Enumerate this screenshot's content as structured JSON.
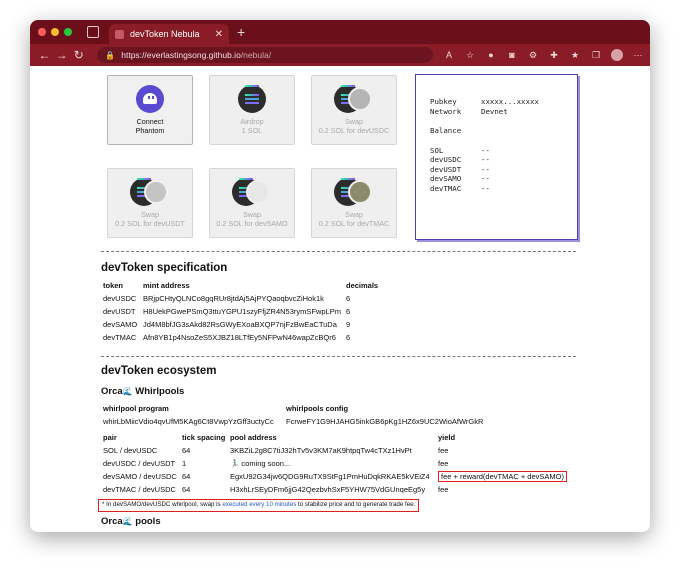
{
  "browser": {
    "tab_title": "devToken Nebula",
    "tab_close": "✕",
    "new_tab": "+",
    "url_domain": "https://everlastingsong.github.io",
    "url_path": "/nebula/"
  },
  "cards": [
    {
      "name": "connect-phantom-card",
      "line1": "Connect",
      "line2": "Phantom",
      "icon": "phantom-icon",
      "active": true
    },
    {
      "name": "airdrop-card",
      "line1": "Airdrop",
      "line2": "1 SOL",
      "icon": "solana-icon"
    },
    {
      "name": "swap-usdc-card",
      "line1": "Swap",
      "line2": "0.2 SOL for devUSDC",
      "icon": "solana-usdc-icon"
    },
    {
      "name": "swap-usdt-card",
      "line1": "Swap",
      "line2": "0.2 SOL for devUSDT",
      "icon": "solana-usdt-icon"
    },
    {
      "name": "swap-samo-card",
      "line1": "Swap",
      "line2": "0.2 SOL for devSAMO",
      "icon": "solana-samo-icon"
    },
    {
      "name": "swap-tmac-card",
      "line1": "Swap",
      "line2": "0.2 SOL for devTMAC",
      "icon": "solana-tmac-icon"
    }
  ],
  "info": {
    "pubkey_label": "Pubkey",
    "pubkey_value": "xxxxx...xxxxx",
    "network_label": "Network",
    "network_value": "Devnet",
    "balance_label": "Balance",
    "balances": [
      {
        "token": "SOL",
        "value": "--"
      },
      {
        "token": "devUSDC",
        "value": "--"
      },
      {
        "token": "devUSDT",
        "value": "--"
      },
      {
        "token": "devSAMO",
        "value": "--"
      },
      {
        "token": "devTMAC",
        "value": "--"
      }
    ]
  },
  "spec": {
    "heading": "devToken specification",
    "headers": [
      "token",
      "mint address",
      "decimals"
    ],
    "rows": [
      [
        "devUSDC",
        "BRjpCHtyQLNCo8gqRUr8jtdAj5AjPYQaoqbvcZiHok1k",
        "6"
      ],
      [
        "devUSDT",
        "H8UekPGwePSmQ3ttuYGPU1szyFfjZR4N53rymSFwpLPm",
        "6"
      ],
      [
        "devSAMO",
        "Jd4M8bfJG3sAkd82RsGWyEXoaBXQP7njFzBwEaCTuDa",
        "9"
      ],
      [
        "devTMAC",
        "Afn8YB1p4NsoZeS5XJBZ18LTfEy5NFPwN46wapZcBQr6",
        "6"
      ]
    ]
  },
  "eco": {
    "heading": "devToken ecosystem",
    "orca_a": "Orca",
    "orca_wave": "🌊",
    "whirlpools_label": "Whirlpools",
    "program_label": "whirlpool program",
    "program_value": "whirLbMiicVdio4qvUfM5KAg6Ct8VwpYzGff3uctyCc",
    "config_label": "whirlpools config",
    "config_value": "FcrweFY1G9HJAHG5inkGB6pKg1HZ6x9UC2WioAfWrGkR",
    "pool_headers": [
      "pair",
      "tick spacing",
      "pool address",
      "yield"
    ],
    "pools": [
      [
        "SOL / devUSDC",
        "64",
        "3KBZiL2g8C7tiJ32hTv5v3KM7aK9htpqTw4cTXz1HvPt",
        "fee"
      ],
      [
        "devUSDC / devUSDT",
        "1",
        "🏃🏻‍♂️ coming soon...",
        "fee"
      ],
      [
        "devSAMO / devUSDC",
        "64",
        "EgxU92G34jw6QDG9RuTX9StFg1PmHuDqkRKAE5kVEiZ4",
        "fee + reward(devTMAC + devSAMO)"
      ],
      [
        "devTMAC / devUSDC",
        "64",
        "H3xhLrSEyDFm6jjG42QezbvhSxF5YHW75VdGUnqeEg5y",
        "fee"
      ]
    ],
    "note_a": "* In devSAMO/devUSDC whirlpool, swap is ",
    "note_b": "executed every 10 minutes",
    "note_c": " to stabilize price and to generate trade fee.",
    "orca_pools_label": "pools"
  }
}
